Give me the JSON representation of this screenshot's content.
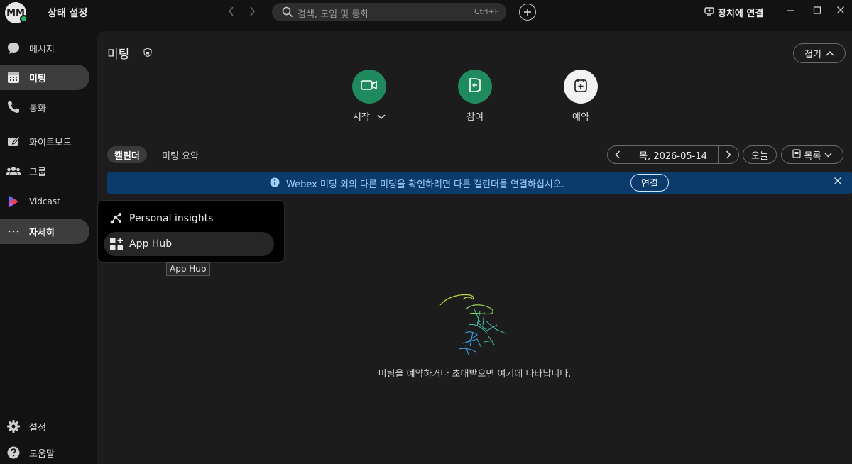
{
  "titlebar": {
    "avatar_initials": "MM",
    "status_label": "상태 설정",
    "search_placeholder": "검색, 모임 및 통화",
    "search_shortcut": "Ctrl+F",
    "device_connect_label": "장치에 연결"
  },
  "sidebar": {
    "items": [
      {
        "label": "메시지",
        "icon": "chat-bubble-icon"
      },
      {
        "label": "미팅",
        "icon": "calendar-icon"
      },
      {
        "label": "통화",
        "icon": "phone-icon"
      },
      {
        "label": "화이트보드",
        "icon": "whiteboard-icon"
      },
      {
        "label": "그룹",
        "icon": "people-icon"
      },
      {
        "label": "Vidcast",
        "icon": "vidcast-icon"
      },
      {
        "label": "자세히",
        "icon": "more-icon"
      }
    ],
    "footer": [
      {
        "label": "설정",
        "icon": "gear-icon"
      },
      {
        "label": "도움말",
        "icon": "help-icon"
      }
    ]
  },
  "main": {
    "title": "미팅",
    "collapse_label": "접기",
    "actions": [
      {
        "label": "시작",
        "icon": "video-icon"
      },
      {
        "label": "참여",
        "icon": "join-icon"
      },
      {
        "label": "예약",
        "icon": "calendar-add-icon"
      }
    ],
    "tabs": [
      {
        "label": "캘린더"
      },
      {
        "label": "미팅 요약"
      }
    ],
    "date_label": "목, 2026-05-14",
    "today_label": "오늘",
    "view_label": "목록",
    "banner_message": "Webex 미팅 외의 다른 미팅을 확인하려면 다른 캘린더를 연결하십시오.",
    "banner_connect_label": "연결",
    "empty_message": "미팅을 예약하거나 초대받으면 여기에 나타납니다."
  },
  "popup": {
    "items": [
      {
        "label": "Personal insights",
        "icon": "insights-icon"
      },
      {
        "label": "App Hub",
        "icon": "app-hub-icon"
      }
    ],
    "tooltip": "App Hub"
  },
  "colors": {
    "accent_green": "#1f8a5e",
    "banner_blue": "#0b3b6b",
    "presence_green": "#2fb36b"
  }
}
